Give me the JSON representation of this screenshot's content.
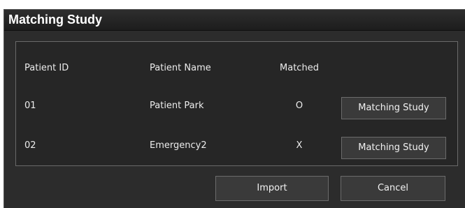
{
  "dialog": {
    "title": "Matching Study"
  },
  "table": {
    "headers": {
      "patient_id": "Patient ID",
      "patient_name": "Patient Name",
      "matched": "Matched"
    },
    "rows": [
      {
        "patient_id": "01",
        "patient_name": "Patient Park",
        "matched": "O",
        "action_label": "Matching Study"
      },
      {
        "patient_id": "02",
        "patient_name": "Emergency2",
        "matched": "X",
        "action_label": "Matching Study"
      }
    ]
  },
  "footer": {
    "import_label": "Import",
    "cancel_label": "Cancel"
  },
  "colors": {
    "dialog_background": "#2c2c2c",
    "panel_background": "#262626",
    "button_background": "#3a3a3a",
    "text": "#ececec"
  }
}
